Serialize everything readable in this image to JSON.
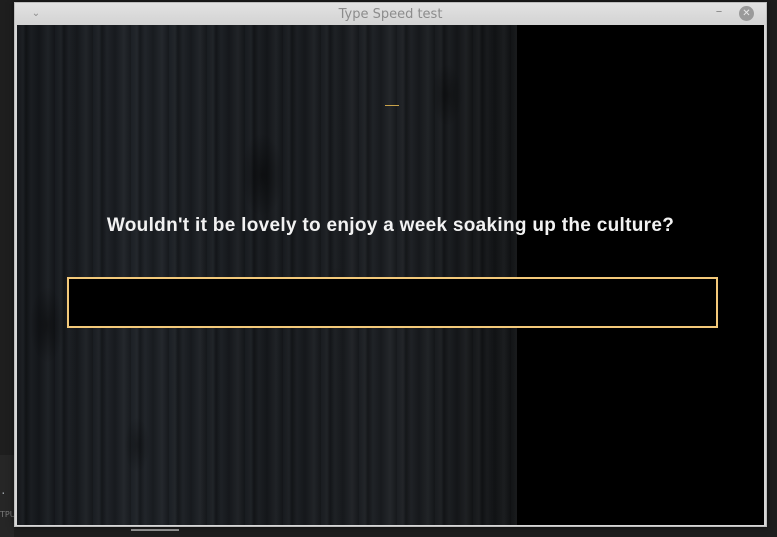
{
  "window": {
    "title": "Type Speed test",
    "minimize_glyph": "–",
    "close_glyph": "✕",
    "menu_glyph": "⌄"
  },
  "test": {
    "sentence": "Wouldn't it be lovely to enjoy a week soaking up the culture?",
    "input_value": "",
    "input_border_color": "#f3c97a"
  },
  "background_app": {
    "bottom_text": ". n",
    "tiny_text": "TPU"
  },
  "icons": {
    "menu": "chevron-down-icon",
    "minimize": "minimize-icon",
    "close": "close-icon"
  }
}
